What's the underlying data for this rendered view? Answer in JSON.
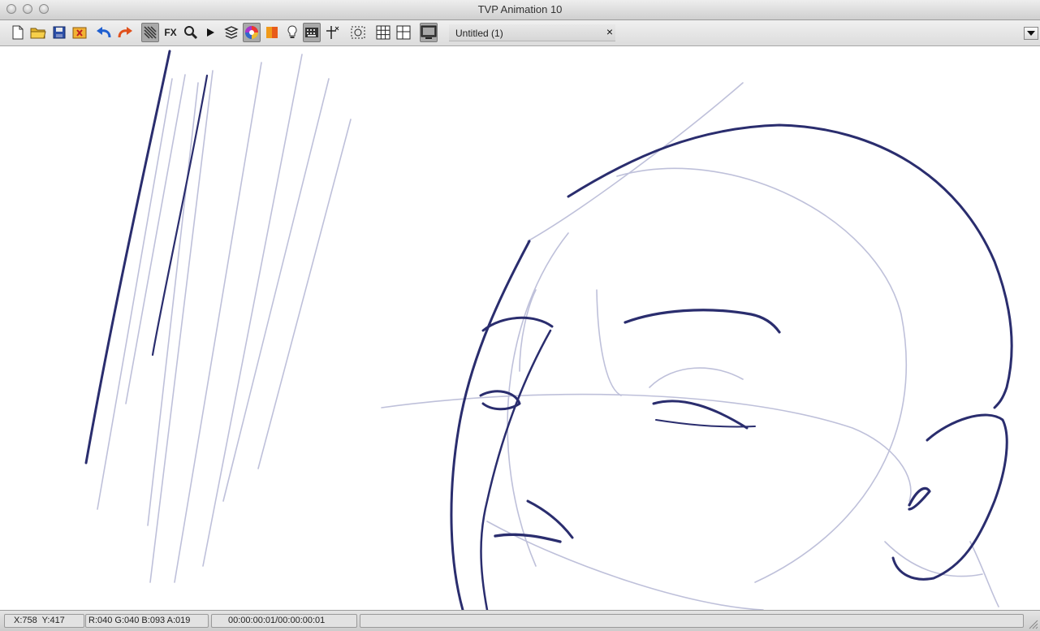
{
  "window": {
    "title": "TVP Animation 10"
  },
  "toolbar": {
    "buttons": [
      {
        "id": "new",
        "icon": "new-document-icon"
      },
      {
        "id": "open",
        "icon": "open-folder-icon"
      },
      {
        "id": "save",
        "icon": "save-disk-icon"
      },
      {
        "id": "close",
        "icon": "close-project-icon"
      },
      {
        "id": "undo",
        "icon": "undo-icon"
      },
      {
        "id": "redo",
        "icon": "redo-icon"
      },
      {
        "id": "lighttable",
        "icon": "light-table-icon"
      },
      {
        "id": "fx",
        "icon": "fx-icon",
        "label": "FX"
      },
      {
        "id": "zoom",
        "icon": "magnifier-icon"
      },
      {
        "id": "play",
        "icon": "play-icon"
      },
      {
        "id": "layers",
        "icon": "layers-icon"
      },
      {
        "id": "color",
        "icon": "color-wheel-icon"
      },
      {
        "id": "palette",
        "icon": "palette-icon"
      },
      {
        "id": "hint",
        "icon": "lightbulb-icon"
      },
      {
        "id": "keyboard",
        "icon": "keyboard-icon"
      },
      {
        "id": "guides",
        "icon": "guides-icon"
      },
      {
        "id": "mask",
        "icon": "mask-icon"
      },
      {
        "id": "grid",
        "icon": "grid-icon"
      },
      {
        "id": "layout",
        "icon": "layout-icon"
      },
      {
        "id": "display",
        "icon": "monitor-icon"
      }
    ]
  },
  "tab": {
    "label": "Untitled (1)",
    "close_glyph": "×"
  },
  "status": {
    "coords": "X:758  Y:417",
    "color": "R:040 G:040 B:093 A:019",
    "timecode": "00:00:00:01/00:00:00:01"
  },
  "colors": {
    "ink": "#2a2d6e",
    "sketch": "#b8bad6"
  }
}
